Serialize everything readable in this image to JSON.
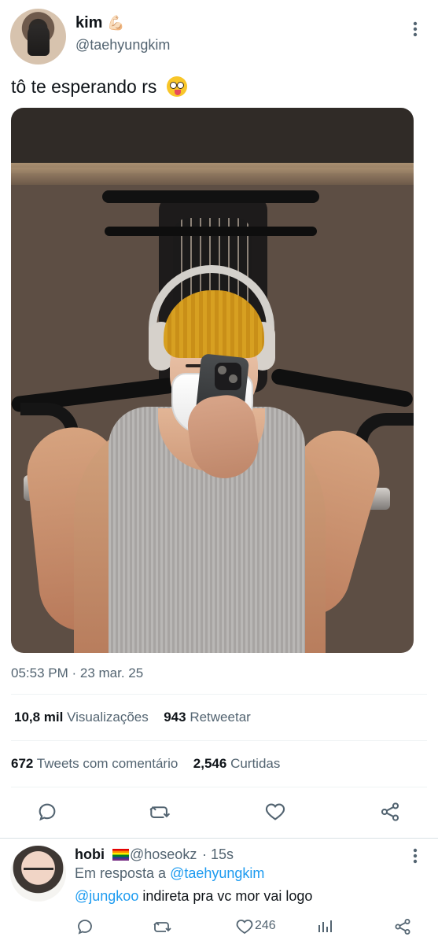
{
  "tweet": {
    "author": {
      "name": "kim",
      "name_emoji": "💪🏻",
      "handle": "@taehyungkim"
    },
    "text": "tô te esperando rs",
    "text_emoji": "🤪",
    "timestamp": "05:53 PM · 23 mar. 25",
    "stats": {
      "views_value": "10,8 mil",
      "views_label": "Visualizações",
      "retweets_value": "943",
      "retweets_label": "Retweetar",
      "comments_value": "672",
      "comments_label": "Tweets com comentário",
      "likes_value": "2,546",
      "likes_label": "Curtidas"
    },
    "actions": [
      {
        "icon": "reply-icon"
      },
      {
        "icon": "retweet-icon"
      },
      {
        "icon": "heart-icon"
      },
      {
        "icon": "share-icon"
      }
    ]
  },
  "reply": {
    "author": {
      "name": "hobi",
      "flag": "rainbow-flag",
      "handle": "@hoseokz",
      "time": "· 15s"
    },
    "context_prefix": "Em resposta a ",
    "context_mention": "@taehyungkim",
    "text_mention": "@jungkoo",
    "text": " indireta pra vc mor vai logo",
    "like_count": "246"
  },
  "colors": {
    "text": "#0f1419",
    "secondary": "#536471",
    "accent": "#1d9bf0"
  }
}
